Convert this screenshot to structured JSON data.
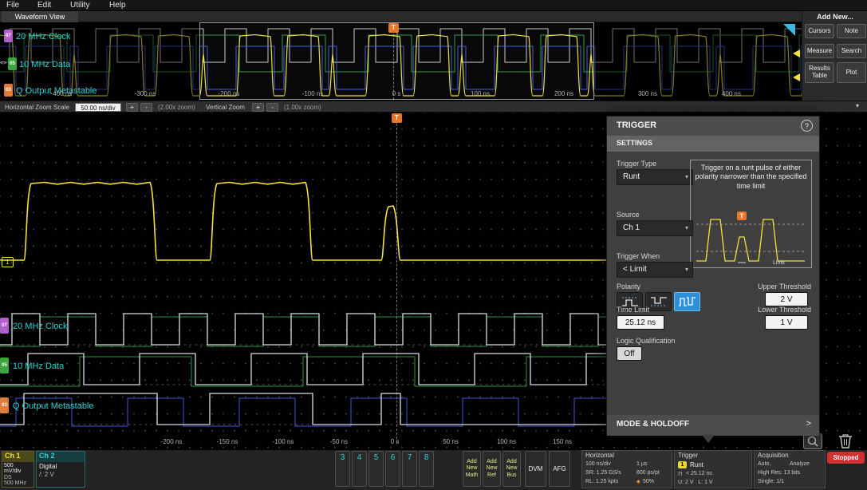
{
  "menu": {
    "items": [
      "File",
      "Edit",
      "Utility",
      "Help"
    ]
  },
  "view_tab": "Waveform View",
  "add_new": {
    "title": "Add New...",
    "buttons": [
      "Cursors",
      "Note",
      "Measure",
      "Search",
      "Results Table",
      "Plot"
    ]
  },
  "channels": {
    "clock": {
      "badge": "07",
      "label": "20 MHz Clock",
      "color": "#b060c8"
    },
    "data": {
      "badge": "05",
      "label": "10 MHz Data",
      "color": "#3da53d"
    },
    "q": {
      "badge": "03",
      "label": "Q Output Metastable",
      "color": "#e07b39"
    }
  },
  "overview_axis": [
    "-400 ns",
    "-300 ns",
    "-200 ns",
    "-100 ns",
    "0 s",
    "100 ns",
    "200 ns",
    "300 ns",
    "400 ns"
  ],
  "main_axis": [
    "-200 ns",
    "-150 ns",
    "-100 ns",
    "-50 ns",
    "0 s",
    "50 ns",
    "100 ns",
    "150 ns"
  ],
  "zoom_bar": {
    "label": "Horizontal Zoom Scale",
    "scale": "50.00 ns/div",
    "plus": "+",
    "minus": "-",
    "h_zoom": "(2.00x zoom)",
    "v_label": "Vertical Zoom",
    "v_zoom": "(1.00x zoom)"
  },
  "trigger_marker": "T",
  "markers": {
    "ch1": "1"
  },
  "icons": {
    "dropdown": "▾",
    "collapse": "▾",
    "expand": ">",
    "bus": "<>",
    "ref_point": "◆",
    "runt_glyph": "⊓",
    "threshold": "/"
  },
  "trigger_panel": {
    "title": "TRIGGER",
    "help": "?",
    "settings": "SETTINGS",
    "type_label": "Trigger Type",
    "type_value": "Runt",
    "source_label": "Source",
    "source_value": "Ch 1",
    "when_label": "Trigger When",
    "when_value": "< Limit",
    "description": "Trigger on a runt pulse of either polarity narrower than the specified time limit",
    "diagram_limit": "Limit",
    "polarity_label": "Polarity",
    "upper_label": "Upper Threshold",
    "upper_value": "2 V",
    "time_limit_label": "Time Limit",
    "time_limit_value": "25.12 ns",
    "lower_label": "Lower Threshold",
    "lower_value": "1 V",
    "logic_label": "Logic Qualification",
    "logic_value": "Off",
    "mode_holdoff": "MODE & HOLDOFF"
  },
  "badges": {
    "ch1": {
      "name": "Ch 1",
      "line1": "500 mV/div",
      "line2": "DS",
      "line3": "500 MHz"
    },
    "ch2": {
      "name": "Ch 2",
      "line1": "Digital",
      "line2": "2 V"
    },
    "channel_numbers": [
      "3",
      "4",
      "5",
      "6",
      "7",
      "8"
    ],
    "add_math": {
      "l1": "Add",
      "l2": "New",
      "l3": "Math"
    },
    "add_ref": {
      "l1": "Add",
      "l2": "New",
      "l3": "Ref"
    },
    "add_bus": {
      "l1": "Add",
      "l2": "New",
      "l3": "Bus"
    },
    "dvm": "DVM",
    "afg": "AFG",
    "horizontal": {
      "title": "Horizontal",
      "c1r1": "100 ns/div",
      "c2r1": "1 µs",
      "c1r2": "SR: 1.25 GS/s",
      "c2r2": "800 ps/pt",
      "c1r3": "RL: 1.25 kpts",
      "c2r3": "50%"
    },
    "trigger": {
      "title": "Trigger",
      "source": "1",
      "type": "Runt",
      "cond": "< 25.12 ns",
      "levels": "U: 2 V   L: 1 V"
    },
    "acquisition": {
      "title": "Acquisition",
      "r1a": "Auto,",
      "r1b": "Analyze",
      "r2": "High Res: 13 bits",
      "r3": "Single: 1/1"
    },
    "stopped": "Stopped"
  },
  "ui_colors": {
    "accent_cyan": "#28d3d3",
    "waveform_yellow": "#f2e23c",
    "trigger_orange": "#e8762a",
    "selected_blue": "#2e8fd8",
    "stopped_red": "#d03030"
  }
}
